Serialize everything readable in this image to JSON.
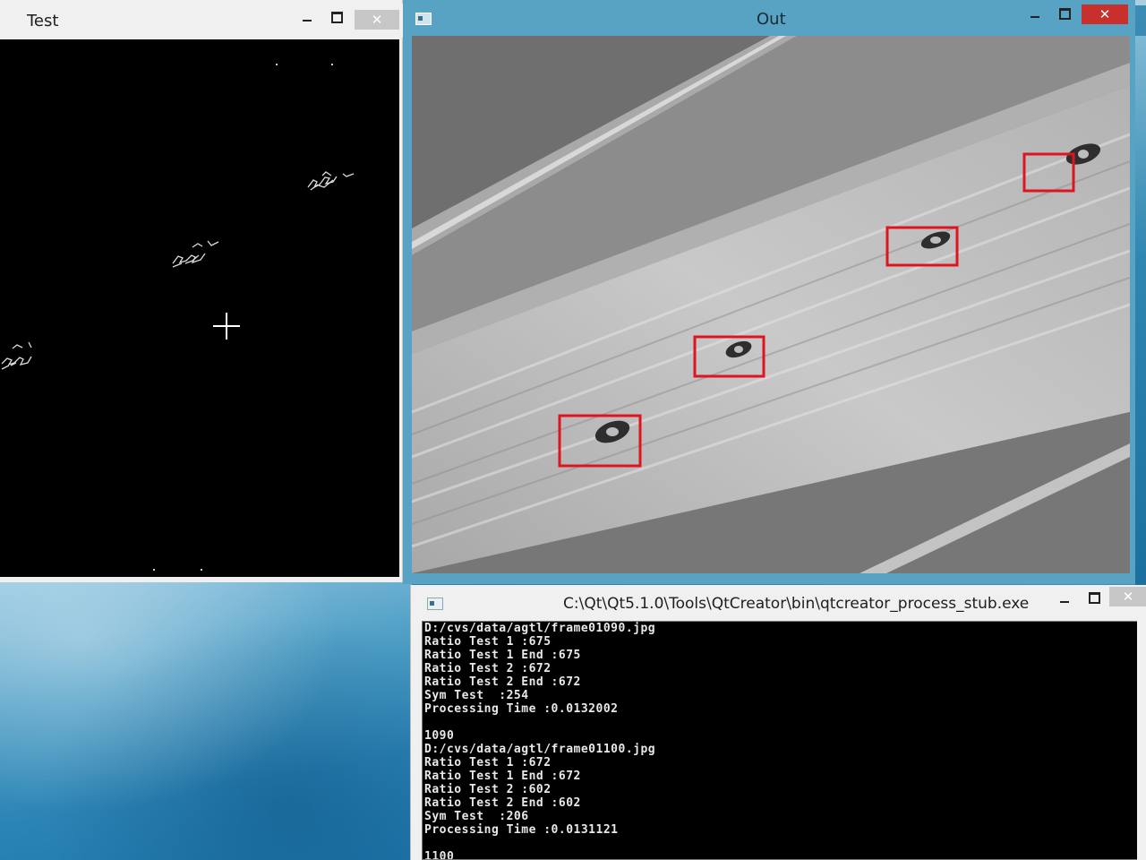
{
  "windows": {
    "test": {
      "title": "Test",
      "close_glyph": "✕"
    },
    "out": {
      "title": "Out",
      "close_glyph": "✕"
    },
    "console": {
      "title": "C:\\Qt\\Qt5.1.0\\Tools\\QtCreator\\bin\\qtcreator_process_stub.exe",
      "close_glyph": "✕",
      "lines": [
        "D:/cvs/data/agtl/frame01090.jpg",
        "Ratio Test 1 :675",
        "Ratio Test 1 End :675",
        "Ratio Test 2 :672",
        "Ratio Test 2 End :672",
        "Sym Test  :254",
        "Processing Time :0.0132002",
        "",
        "1090",
        "D:/cvs/data/agtl/frame01100.jpg",
        "Ratio Test 1 :672",
        "Ratio Test 1 End :672",
        "Ratio Test 2 :602",
        "Ratio Test 2 End :602",
        "Sym Test  :206",
        "Processing Time :0.0131121",
        "",
        "1100"
      ]
    }
  },
  "colors": {
    "detection_box": "#e0141e",
    "out_frame": "#58a3c4",
    "close_active": "#c9302c"
  },
  "icons": [
    "minimize-icon",
    "maximize-icon",
    "close-icon",
    "window-system-icon",
    "crosshair-cursor-icon"
  ]
}
